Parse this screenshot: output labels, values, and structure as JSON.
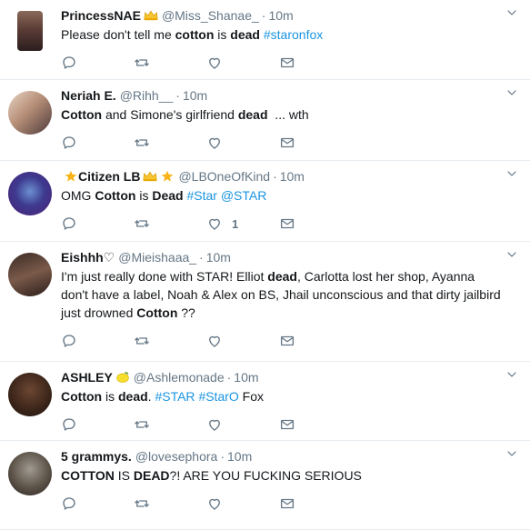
{
  "tweets": [
    {
      "name": "PrincessNAE",
      "badges": [
        "crown"
      ],
      "handle": "@Miss_Shanae_",
      "dot": "·",
      "time": "10m",
      "segments": [
        {
          "t": "Please don't tell me "
        },
        {
          "t": "cotton",
          "b": true
        },
        {
          "t": " is "
        },
        {
          "t": "dead",
          "b": true
        },
        {
          "t": " "
        },
        {
          "t": "#staronfox",
          "tag": true
        }
      ],
      "likes": ""
    },
    {
      "name": "Neriah E.",
      "badges": [],
      "handle": "@Rihh__",
      "dot": "·",
      "time": "10m",
      "segments": [
        {
          "t": "Cotton",
          "b": true
        },
        {
          "t": " and Simone's girlfriend "
        },
        {
          "t": "dead",
          "b": true
        },
        {
          "t": "  ... wth"
        }
      ],
      "likes": ""
    },
    {
      "name": "Citizen LB",
      "badges_before": [
        "star"
      ],
      "badges": [
        "crown",
        "star"
      ],
      "handle": "@LBOneOfKind",
      "dot": "·",
      "time": "10m",
      "segments": [
        {
          "t": "OMG "
        },
        {
          "t": "Cotton",
          "b": true
        },
        {
          "t": " is "
        },
        {
          "t": "Dead",
          "b": true
        },
        {
          "t": " "
        },
        {
          "t": "#Star",
          "tag": true
        },
        {
          "t": " "
        },
        {
          "t": "@STAR",
          "tag": true
        }
      ],
      "likes": "1"
    },
    {
      "name": "Eishhh♡",
      "badges": [],
      "handle": "@Mieishaaa_",
      "dot": "·",
      "time": "10m",
      "segments": [
        {
          "t": "I'm just really done with STAR! Elliot "
        },
        {
          "t": "dead",
          "b": true
        },
        {
          "t": ", Carlotta lost her shop, Ayanna don't have a label, Noah & Alex on BS, Jhail unconscious and that dirty jailbird just drowned "
        },
        {
          "t": "Cotton",
          "b": true
        },
        {
          "t": " ??"
        }
      ],
      "likes": ""
    },
    {
      "name": "ASHLEY",
      "badges": [
        "lemon"
      ],
      "handle": "@Ashlemonade",
      "dot": "·",
      "time": "10m",
      "segments": [
        {
          "t": "Cotton",
          "b": true
        },
        {
          "t": " is "
        },
        {
          "t": "dead",
          "b": true
        },
        {
          "t": ". "
        },
        {
          "t": "#STAR",
          "tag": true
        },
        {
          "t": " "
        },
        {
          "t": "#StarO",
          "tag": true
        },
        {
          "t": " Fox"
        }
      ],
      "likes": ""
    },
    {
      "name": "5 grammys.",
      "badges": [],
      "handle": "@lovesephora",
      "dot": "·",
      "time": "10m",
      "segments": [
        {
          "t": "COTTON",
          "b": true
        },
        {
          "t": " IS "
        },
        {
          "t": "DEAD",
          "b": true
        },
        {
          "t": "?! ARE YOU FUCKING SERIOUS"
        }
      ],
      "likes": ""
    }
  ],
  "colors": {
    "link": "#1b95e0",
    "muted": "#657786",
    "divider": "#e6ecf0"
  },
  "icons": {
    "reply": "reply-icon",
    "retweet": "retweet-icon",
    "like": "heart-icon",
    "dm": "mail-icon",
    "more": "chevron-down-icon"
  }
}
